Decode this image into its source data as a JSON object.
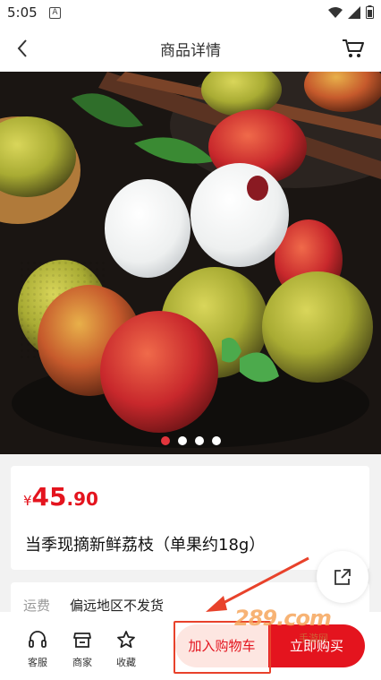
{
  "status": {
    "time": "5:05",
    "notification_letter": "A"
  },
  "header": {
    "title": "商品详情"
  },
  "carousel": {
    "dot_count": 4,
    "active_index": 0
  },
  "product": {
    "currency": "¥",
    "price_int": "45",
    "price_dec": ".90",
    "name": "当季现摘新鲜荔枝（单果约18g）"
  },
  "shipping": {
    "label": "运费",
    "value": "偏远地区不发货"
  },
  "bottom": {
    "service": "客服",
    "shop": "商家",
    "favorite": "收藏",
    "add_to_cart": "加入购物车",
    "buy_now": "立即购买"
  },
  "watermark": {
    "logo": "289.com",
    "sub": "手游网"
  },
  "colors": {
    "accent": "#e4141e",
    "annotation": "#e8422b"
  }
}
